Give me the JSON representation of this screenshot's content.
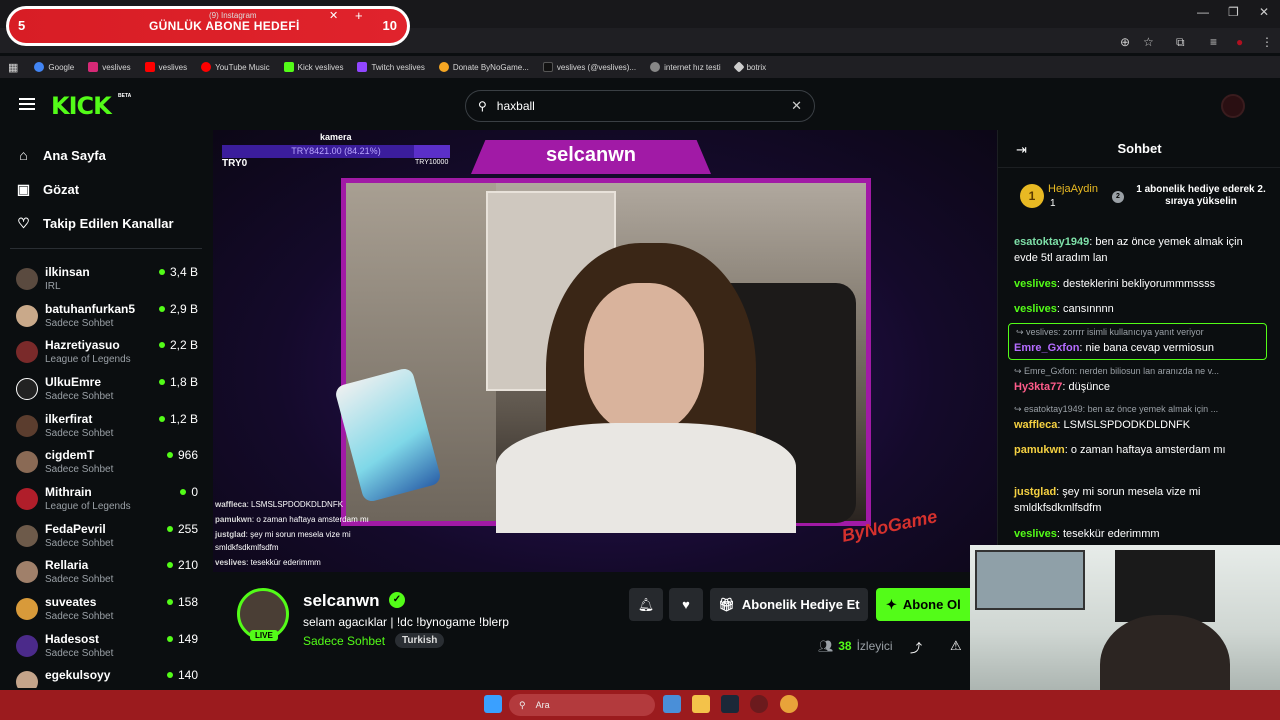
{
  "goal": {
    "tab_title": "(9) Instagram",
    "left": "5",
    "title": "GÜNLÜK ABONE HEDEFİ",
    "right": "10"
  },
  "window": {
    "minimize": "—",
    "maximize": "❐",
    "close": "✕"
  },
  "bookmarks": [
    {
      "label": "Google",
      "color": "#4285f4"
    },
    {
      "label": "veslives",
      "color": "#d62976"
    },
    {
      "label": "veslives",
      "color": "#ff0000"
    },
    {
      "label": "YouTube Music",
      "color": "#ff0000"
    },
    {
      "label": "Kick veslives",
      "color": "#53fc18"
    },
    {
      "label": "Twitch veslives",
      "color": "#9146ff"
    },
    {
      "label": "Donate ByNoGame...",
      "color": "#f5a623"
    },
    {
      "label": "veslives (@veslives)...",
      "color": "#111111"
    },
    {
      "label": "internet hız testi",
      "color": "#888888"
    },
    {
      "label": "botrix",
      "color": "#cccccc"
    }
  ],
  "header": {
    "logo": "KICK",
    "beta": "BETA",
    "search_value": "haxball"
  },
  "nav": [
    {
      "label": "Ana Sayfa",
      "icon": "home-icon"
    },
    {
      "label": "Gözat",
      "icon": "browse-icon"
    },
    {
      "label": "Takip Edilen Kanallar",
      "icon": "heart-icon"
    }
  ],
  "channels": [
    {
      "name": "ilkinsan",
      "category": "IRL",
      "viewers": "3,4 B"
    },
    {
      "name": "batuhanfurkan5",
      "category": "Sadece Sohbet",
      "viewers": "2,9 B"
    },
    {
      "name": "Hazretiyasuo",
      "category": "League of Legends",
      "viewers": "2,2 B"
    },
    {
      "name": "UlkuEmre",
      "category": "Sadece Sohbet",
      "viewers": "1,8 B"
    },
    {
      "name": "ilkerfirat",
      "category": "Sadece Sohbet",
      "viewers": "1,2 B"
    },
    {
      "name": "cigdemT",
      "category": "Sadece Sohbet",
      "viewers": "966"
    },
    {
      "name": "Mithrain",
      "category": "League of Legends",
      "viewers": "0"
    },
    {
      "name": "FedaPevril",
      "category": "Sadece Sohbet",
      "viewers": "255"
    },
    {
      "name": "Rellaria",
      "category": "Sadece Sohbet",
      "viewers": "210"
    },
    {
      "name": "suveates",
      "category": "Sadece Sohbet",
      "viewers": "158"
    },
    {
      "name": "Hadesost",
      "category": "Sadece Sohbet",
      "viewers": "149"
    },
    {
      "name": "egekulsoyy",
      "category": "",
      "viewers": "140"
    }
  ],
  "player": {
    "cam_label": "kamera",
    "goal_bar_text": "TRY8421.00 (84.21%)",
    "goal_progress": 0.8421,
    "goal_min": "TRY0",
    "goal_max": "TRY10000",
    "banner": "selcanwn",
    "overlay_chat": [
      {
        "user": "waffleca",
        "text": ": LSMSLSPDODKDLDNFK"
      },
      {
        "user": "pamukwn",
        "text": ": o zaman haftaya amsterdam mı"
      },
      {
        "user": "justglad",
        "text": ": şey mi sorun mesela vize mi"
      },
      {
        "user": "",
        "text": "smldkfsdkmlfsdfm"
      },
      {
        "user": "veslives",
        "text": ": tesekkür ederimmm"
      }
    ]
  },
  "stream": {
    "streamer": "selcanwn",
    "live": "LIVE",
    "title": "selam agacıklar | !dc !bynogame !blerp",
    "category": "Sadece Sohbet",
    "language": "Turkish",
    "gift_label": "Abonelik Hediye Et",
    "sub_label": "Abone Ol",
    "viewers": "38",
    "viewers_label": "İzleyici"
  },
  "chat": {
    "title": "Sohbet",
    "leader": {
      "rank": "1",
      "user": "HejaAydin",
      "count": "1",
      "rank2": "2",
      "hint": "1 abonelik hediye ederek 2. sıraya yükselin"
    },
    "messages": [
      {
        "user": "esatoktay1949",
        "color": "#7ee0a8",
        "text": "ben az önce yemek almak için evde 5tl aradım lan"
      },
      {
        "user": "veslives",
        "color": "#53fc18",
        "text": "desteklerini bekliyorummmssss"
      },
      {
        "user": "veslives",
        "color": "#53fc18",
        "text": "cansınnnn"
      },
      {
        "reply": "veslives: zorrrr isimli kullanıcıya yanıt veriyor"
      },
      {
        "user": "Emre_Gxfon",
        "color": "#b56cff",
        "text": "nie bana cevap vermiosun"
      },
      {
        "reply": "Emre_Gxfon: nerden biliosun lan aranızda ne v..."
      },
      {
        "user": "Hy3kta77",
        "color": "#ff5c8a",
        "text": "düşünce"
      },
      {
        "reply": "esatoktay1949: ben az önce yemek almak için ..."
      },
      {
        "user": "waffleca",
        "color": "#f5d142",
        "text": "LSMSLSPDODKDLDNFK"
      },
      {
        "user": "pamukwn",
        "color": "#f5d142",
        "text": "o zaman haftaya amsterdam mı"
      },
      {
        "user": "justglad",
        "color": "#f5d142",
        "text": "şey mi sorun mesela vize mi smldkfsdkmlfsdfm"
      },
      {
        "user": "veslives",
        "color": "#53fc18",
        "text": "tesekkür ederimmm"
      }
    ]
  },
  "taskbar": {
    "search": "Ara"
  }
}
